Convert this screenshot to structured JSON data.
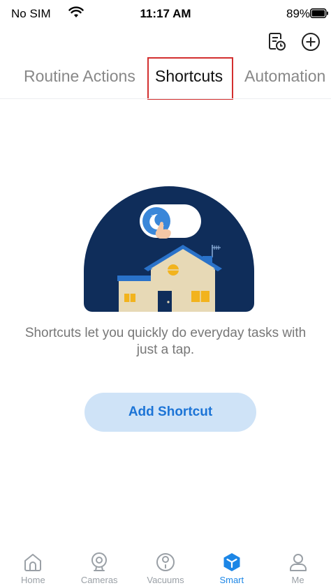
{
  "status_bar": {
    "carrier": "No SIM",
    "time": "11:17 AM",
    "battery": "89%"
  },
  "header": {
    "actions": [
      {
        "icon": "log-icon"
      },
      {
        "icon": "add-circle-icon"
      }
    ]
  },
  "tabs": [
    {
      "label": "Routine Actions",
      "selected": false
    },
    {
      "label": "Shortcuts",
      "selected": true
    },
    {
      "label": "Automation",
      "selected": false
    }
  ],
  "empty_state": {
    "description": "Shortcuts let you quickly do everyday tasks with just a tap.",
    "button_label": "Add Shortcut"
  },
  "bottom_nav": [
    {
      "label": "Home",
      "icon": "home-icon",
      "active": false
    },
    {
      "label": "Cameras",
      "icon": "camera-icon",
      "active": false
    },
    {
      "label": "Vacuums",
      "icon": "vacuum-icon",
      "active": false
    },
    {
      "label": "Smart",
      "icon": "smart-cube-icon",
      "active": true
    },
    {
      "label": "Me",
      "icon": "person-icon",
      "active": false
    }
  ],
  "colors": {
    "accent": "#1c86e6",
    "button_bg": "#cfe3f7",
    "button_text": "#1c74d6",
    "illustration_navy": "#0f2d5a",
    "highlight_box": "#d32f2f"
  }
}
